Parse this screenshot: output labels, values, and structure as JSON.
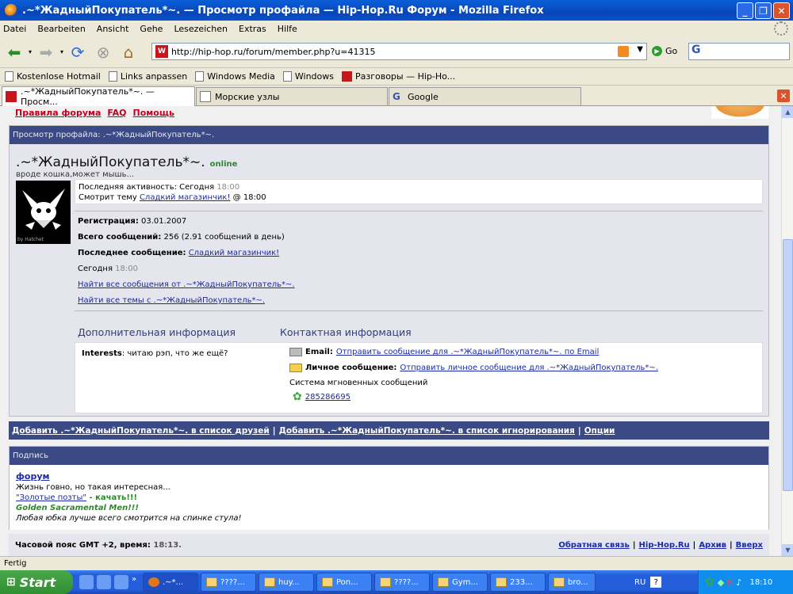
{
  "window": {
    "title": ".~*ЖадныйПокупатель*~. — Просмотр профайла — Hip-Hop.Ru Форум - Mozilla Firefox"
  },
  "menu": [
    "Datei",
    "Bearbeiten",
    "Ansicht",
    "Gehe",
    "Lesezeichen",
    "Extras",
    "Hilfe"
  ],
  "nav": {
    "url": "http://hip-hop.ru/forum/member.php?u=41315",
    "go_label": "Go",
    "search_value": "G"
  },
  "bookmarks": [
    "Kostenlose Hotmail",
    "Links anpassen",
    "Windows Media",
    "Windows",
    "Разговоры — Hip-Ho..."
  ],
  "tabs": [
    ".~*ЖадныйПокупатель*~. — Просм...",
    "Морские узлы",
    "Google"
  ],
  "page": {
    "top_links": [
      "Правила форума",
      "FAQ",
      "Помощь"
    ],
    "profile_header": "Просмотр профайла: .~*ЖадныйПокупатель*~.",
    "username": ".~*ЖадныйПокупатель*~.",
    "online": "online",
    "tagline": "вроде кошка,может мышь...",
    "avatar_caption": "by Hatchet",
    "last_activity_label": "Последняя активность: Сегодня",
    "last_activity_time": "18:00",
    "viewing_prefix": "Смотрит тему",
    "viewing_link": "Сладкий магазинчик!",
    "viewing_suffix": "@ 18:00",
    "reg_label": "Регистрация:",
    "reg_value": "03.01.2007",
    "posts_label": "Всего сообщений:",
    "posts_value": "256 (2.91 сообщений в день)",
    "last_post_label": "Последнее сообщение:",
    "last_post_link": "Сладкий магазинчик!",
    "last_post_day": "Сегодня",
    "last_post_time": "18:00",
    "find_posts": "Найти все сообщения от .~*ЖадныйПокупатель*~.",
    "find_threads": "Найти все темы с .~*ЖадныйПокупатель*~.",
    "extra_info_title": "Дополнительная информация",
    "contact_title": "Контактная информация",
    "interests_label": "Interests",
    "interests_value": ": читаю рэп, что же ещё?",
    "email_label": "Email:",
    "email_link": "Отправить сообщение для .~*ЖадныйПокупатель*~. по Email",
    "pm_label": "Личное сообщение:",
    "pm_link": "Отправить личное сообщение для .~*ЖадныйПокупатель*~.",
    "im_label": "Система мгновенных сообщений",
    "icq_number": "285286695",
    "add_friend": "Добавить .~*ЖадныйПокупатель*~. в список друзей",
    "add_ignore": "Добавить .~*ЖадныйПокупатель*~. в список игнорирования",
    "options": "Опции",
    "signature_header": "Подпись",
    "sig_line1": "форум",
    "sig_line2": "Жизнь говно, но такая интересная...",
    "sig_line3_link": "\"Золотые позты\"",
    "sig_line3_rest": " - качать!!!",
    "sig_line4": "Golden Sacramental Men!!!",
    "sig_line5": "Любая юбка лучше всего смотрится на спинке стула!",
    "timezone_label": "Часовой пояс GMT +2, время:",
    "timezone_time": "18:13.",
    "footer_links": [
      "Обратная связь",
      "Hip-Hop.Ru",
      "Архив",
      "Вверх"
    ]
  },
  "status": "Fertig",
  "taskbar": {
    "start": "Start",
    "items": [
      ".~*...",
      "????...",
      "huy...",
      "Pon...",
      "????...",
      "Gym...",
      "233...",
      "bro..."
    ],
    "lang": "RU",
    "clock": "18:10"
  },
  "colors": {
    "panel_header": "#3b4a85",
    "link": "#1a2aa8",
    "top_link": "#c0001e"
  }
}
